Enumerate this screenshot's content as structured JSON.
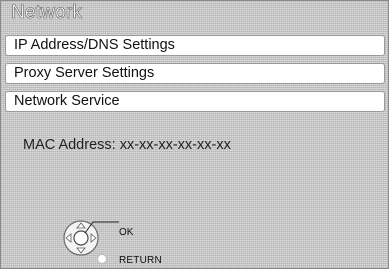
{
  "title": "Network",
  "menu": {
    "items": [
      {
        "label": "IP Address/DNS Settings"
      },
      {
        "label": "Proxy Server Settings"
      },
      {
        "label": "Network Service"
      }
    ]
  },
  "mac": {
    "label": "MAC Address: xx-xx-xx-xx-xx-xx"
  },
  "controls": {
    "ok_label": "OK",
    "return_label": "RETURN"
  }
}
